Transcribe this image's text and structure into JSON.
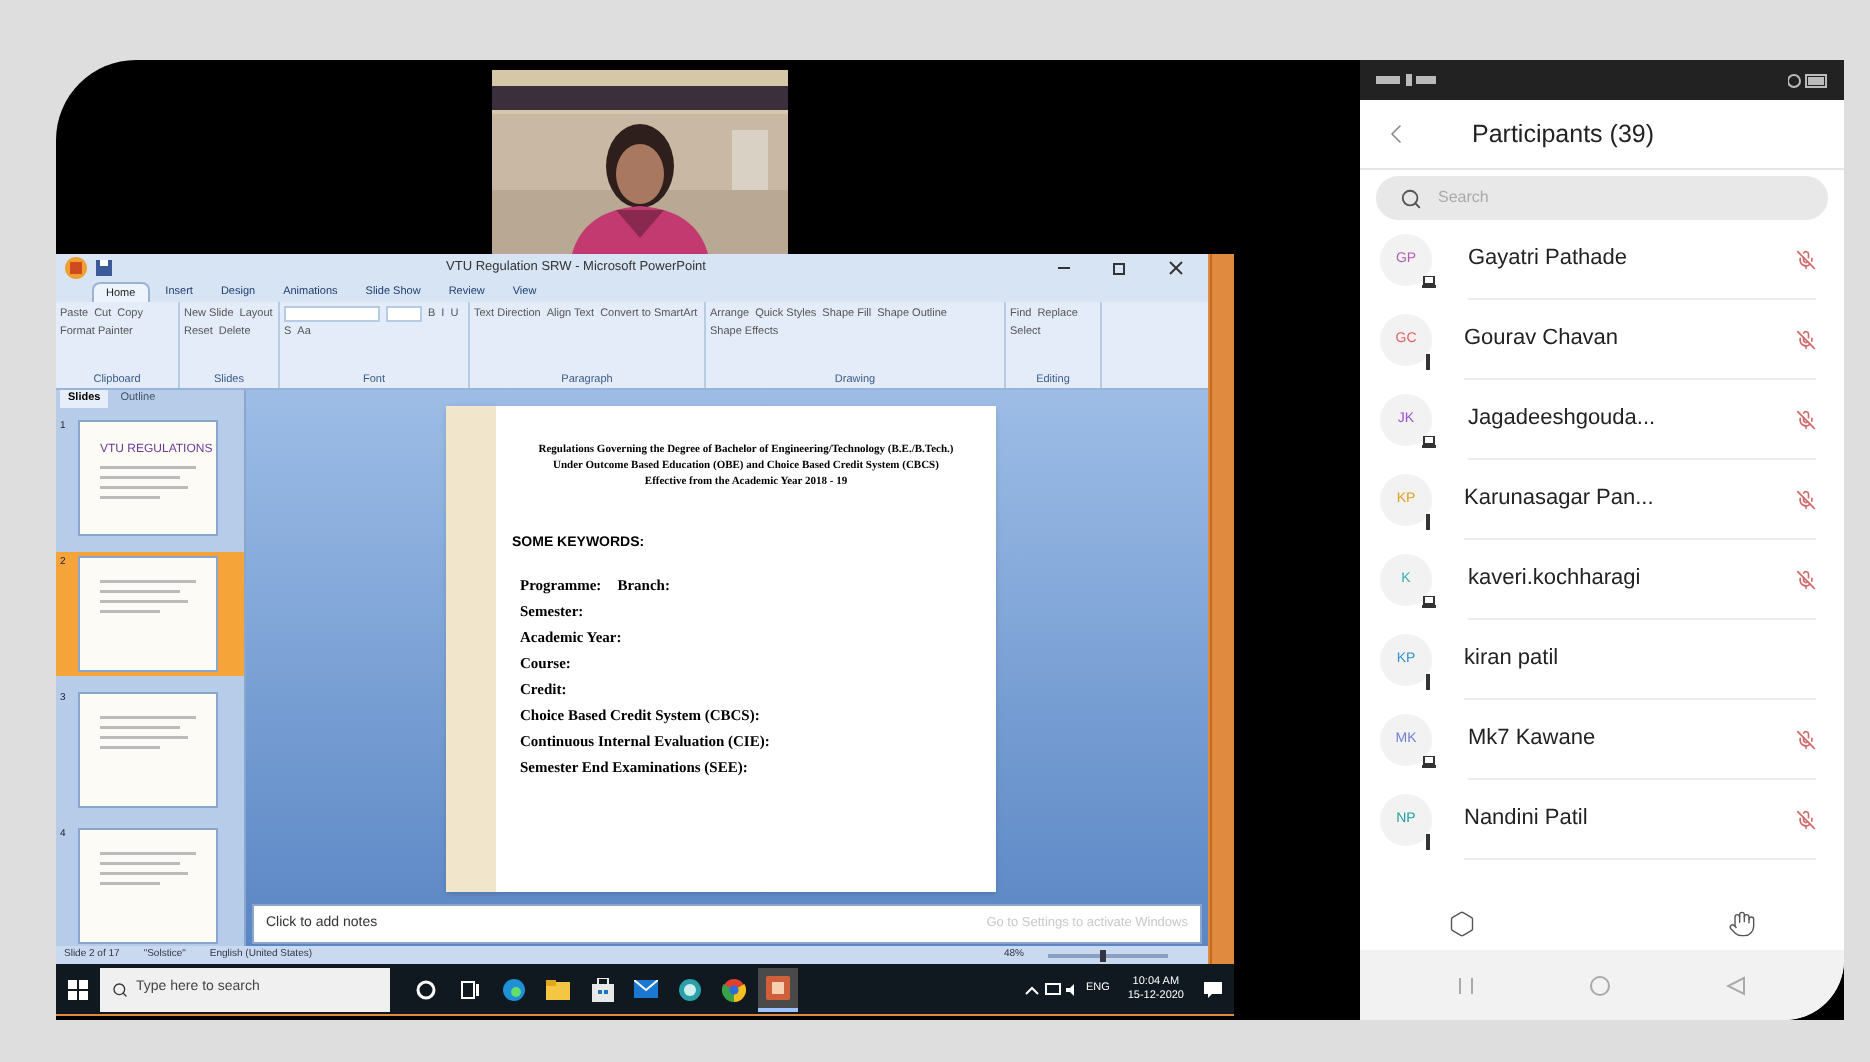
{
  "powerpoint": {
    "title": "VTU Regulation SRW - Microsoft PowerPoint",
    "ribbon_tabs": [
      {
        "label": "Home",
        "selected": true
      },
      {
        "label": "Insert",
        "selected": false
      },
      {
        "label": "Design",
        "selected": false
      },
      {
        "label": "Animations",
        "selected": false
      },
      {
        "label": "Slide Show",
        "selected": false
      },
      {
        "label": "Review",
        "selected": false
      },
      {
        "label": "View",
        "selected": false
      }
    ],
    "ribbon_groups": [
      {
        "name": "Clipboard",
        "commands": [
          "Paste",
          "Cut",
          "Copy",
          "Format Painter"
        ]
      },
      {
        "name": "Slides",
        "commands": [
          "New Slide",
          "Layout",
          "Reset",
          "Delete"
        ]
      },
      {
        "name": "Font",
        "commands": [
          "B",
          "I",
          "U",
          "S",
          "Aa"
        ]
      },
      {
        "name": "Paragraph",
        "commands": [
          "Text Direction",
          "Align Text",
          "Convert to SmartArt"
        ]
      },
      {
        "name": "Drawing",
        "commands": [
          "Arrange",
          "Quick Styles",
          "Shape Fill",
          "Shape Outline",
          "Shape Effects"
        ]
      },
      {
        "name": "Editing",
        "commands": [
          "Find",
          "Replace",
          "Select"
        ]
      }
    ],
    "pane_tabs": [
      {
        "label": "Slides",
        "selected": true
      },
      {
        "label": "Outline",
        "selected": false
      }
    ],
    "thumbnails": [
      {
        "number": "1",
        "selected": false,
        "heading": "VTU REGULATIONS"
      },
      {
        "number": "2",
        "selected": true
      },
      {
        "number": "3",
        "selected": false
      },
      {
        "number": "4",
        "selected": false
      }
    ],
    "slide": {
      "title_lines": [
        "Regulations Governing the Degree of Bachelor of Engineering/Technology (B.E./B.Tech.)",
        "Under Outcome Based Education (OBE) and Choice Based Credit System (CBCS)",
        "Effective from the Academic Year 2018 - 19"
      ],
      "heading": "SOME KEYWORDS:",
      "items": [
        {
          "parts": [
            "Programme:",
            "Branch:"
          ]
        },
        {
          "parts": [
            "Semester:"
          ]
        },
        {
          "parts": [
            "Academic Year:"
          ]
        },
        {
          "parts": [
            "Course:"
          ]
        },
        {
          "parts": [
            "Credit:"
          ]
        },
        {
          "parts": [
            "Choice Based Credit System (CBCS):"
          ]
        },
        {
          "parts": [
            "Continuous Internal Evaluation (CIE):"
          ]
        },
        {
          "parts": [
            "Semester End Examinations (SEE):"
          ]
        }
      ]
    },
    "notes_placeholder": "Click to add notes",
    "activation_notice": "Go to Settings to activate Windows",
    "status": [
      "Slide 2 of 17",
      "\"Solstice\"",
      "English (United States)"
    ],
    "zoom": {
      "reading": "48%",
      "level": 0.45
    }
  },
  "taskbar": {
    "search_placeholder": "Type here to search",
    "language": "ENG",
    "time": "10:04 AM",
    "date": "15-12-2020",
    "apps": [
      {
        "kind": "cortana",
        "selected": false
      },
      {
        "kind": "taskview",
        "selected": false
      },
      {
        "kind": "edge",
        "selected": false
      },
      {
        "kind": "explorer",
        "selected": false
      },
      {
        "kind": "store",
        "selected": false
      },
      {
        "kind": "mail",
        "selected": false
      },
      {
        "kind": "globe",
        "selected": false
      },
      {
        "kind": "chrome",
        "selected": false
      },
      {
        "kind": "powerpoint",
        "selected": true
      }
    ]
  },
  "phone": {
    "title": "Participants (39)",
    "search_placeholder": "Search",
    "participants": [
      {
        "initials": "GP",
        "name": "Gayatri Pathade",
        "color": "#b05fb0",
        "kind": "laptop",
        "muted": true
      },
      {
        "initials": "GC",
        "name": "Gourav Chavan",
        "color": "#e06060",
        "kind": "phone",
        "muted": true
      },
      {
        "initials": "JK",
        "name": "Jagadeeshgouda...",
        "color": "#9a4fd0",
        "kind": "laptop",
        "muted": true
      },
      {
        "initials": "KP",
        "name": "Karunasagar Pan...",
        "color": "#e0a020",
        "kind": "phone",
        "muted": true
      },
      {
        "initials": "K",
        "name": "kaveri.kochharagi",
        "color": "#30b0b0",
        "kind": "laptop",
        "muted": true
      },
      {
        "initials": "KP",
        "name": "kiran patil",
        "color": "#3090d0",
        "kind": "phone",
        "muted": false
      },
      {
        "initials": "MK",
        "name": "Mk7 Kawane",
        "color": "#7080d0",
        "kind": "laptop",
        "muted": true
      },
      {
        "initials": "NP",
        "name": "Nandini Patil",
        "color": "#20a0a0",
        "kind": "phone",
        "muted": true
      }
    ]
  }
}
